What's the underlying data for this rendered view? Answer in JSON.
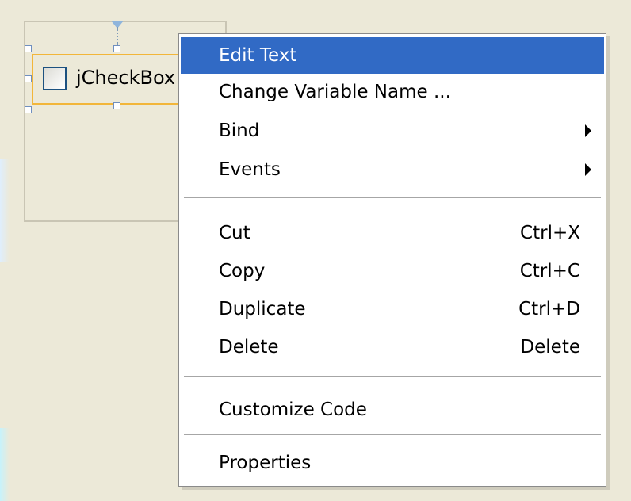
{
  "component": {
    "label": "jCheckBox"
  },
  "menu": {
    "edit_text": "Edit Text",
    "change_variable_name": "Change Variable Name ...",
    "bind": "Bind",
    "events": "Events",
    "cut": "Cut",
    "cut_shortcut": "Ctrl+X",
    "copy": "Copy",
    "copy_shortcut": "Ctrl+C",
    "duplicate": "Duplicate",
    "duplicate_shortcut": "Ctrl+D",
    "delete": "Delete",
    "delete_shortcut": "Delete",
    "customize_code": "Customize Code",
    "properties": "Properties",
    "highlighted_item": "Edit Text"
  },
  "colors": {
    "background": "#ece9d8",
    "menu_highlight": "#316ac5",
    "selection_border": "#f2b63a"
  },
  "icons": {
    "submenu": "submenu-arrow-icon",
    "anchor": "anchor-arrow-icon",
    "checkbox": "checkbox-icon"
  }
}
